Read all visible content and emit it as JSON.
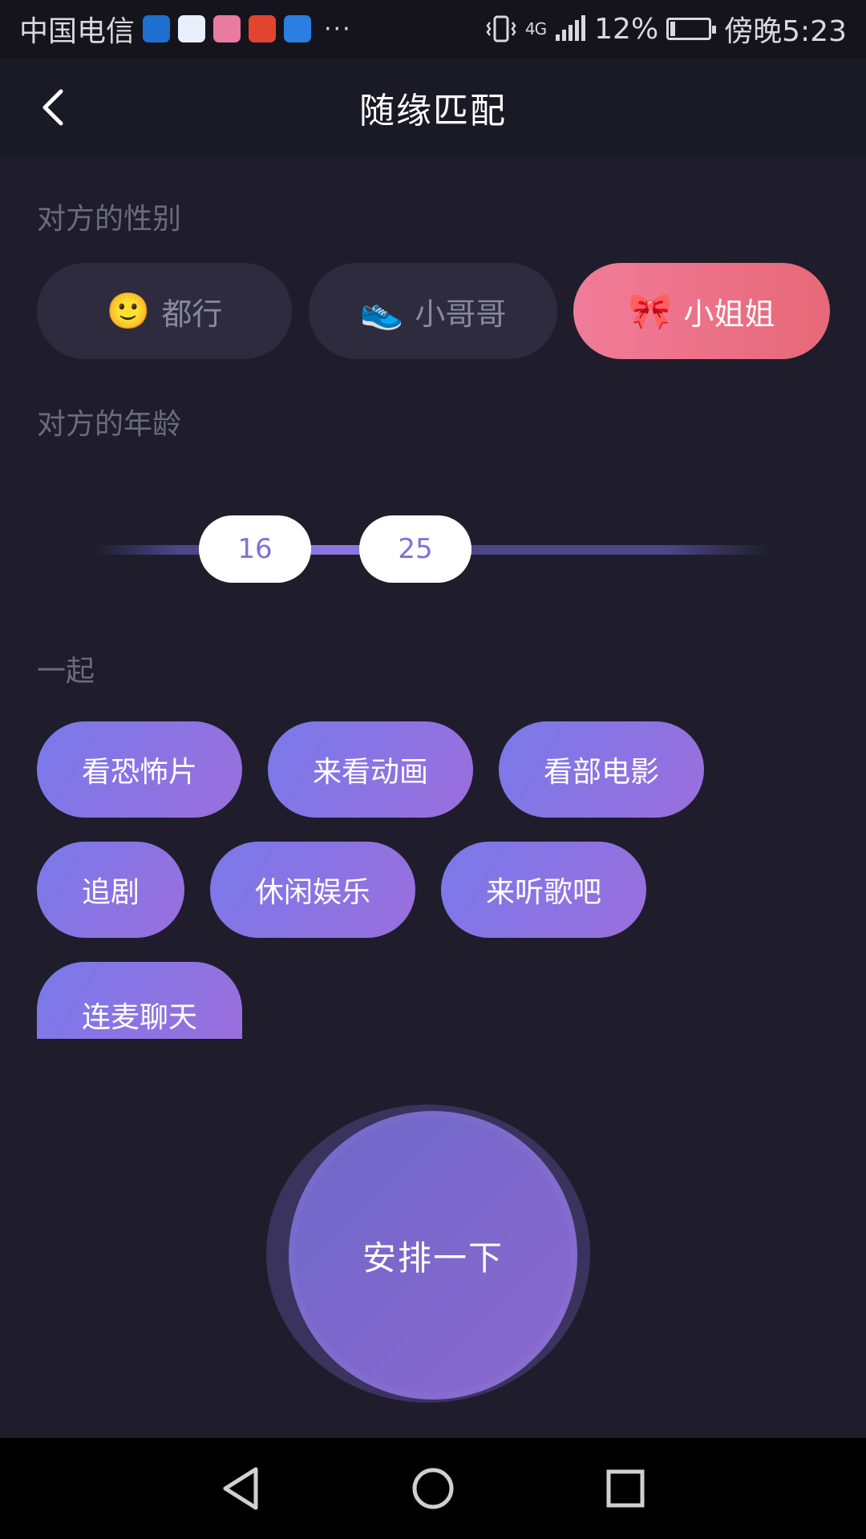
{
  "status_bar": {
    "carrier": "中国电信",
    "more": "···",
    "network": "4G",
    "battery_percent": "12%",
    "time": "傍晚5:23"
  },
  "header": {
    "title": "随缘匹配"
  },
  "gender": {
    "label": "对方的性别",
    "options": [
      {
        "emoji": "🙂",
        "label": "都行"
      },
      {
        "emoji": "👟",
        "label": "小哥哥"
      },
      {
        "emoji": "🎀",
        "label": "小姐姐"
      }
    ],
    "selected": "小姐姐"
  },
  "age": {
    "label": "对方的年龄",
    "min_value": "16",
    "max_value": "25"
  },
  "together": {
    "label": "一起",
    "chips": [
      "看恐怖片",
      "来看动画",
      "看部电影",
      "追剧",
      "休闲娱乐",
      "来听歌吧",
      "连麦聊天"
    ]
  },
  "cta": {
    "label": "安排一下"
  },
  "colors": {
    "background": "#1f1d2c",
    "selected_pill": "#ee7189",
    "chip_gradient_start": "#7a79ea",
    "chip_gradient_end": "#9a6fdc",
    "slider_handle_text": "#7d72d6"
  }
}
